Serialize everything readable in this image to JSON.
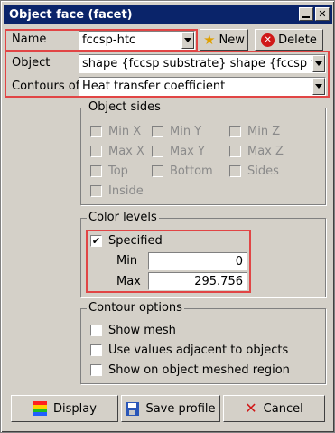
{
  "window": {
    "title": "Object face (facet)"
  },
  "name_row": {
    "label": "Name",
    "value": "fccsp-htc",
    "new_label": "New",
    "delete_label": "Delete"
  },
  "object_row": {
    "label": "Object",
    "value": "shape {fccsp substrate} shape {fccsp flipdie"
  },
  "contours_row": {
    "label": "Contours of",
    "value": "Heat transfer coefficient"
  },
  "object_sides": {
    "title": "Object sides",
    "items": [
      "Min X",
      "Min Y",
      "Min Z",
      "Max X",
      "Max Y",
      "Max Z",
      "Top",
      "Bottom",
      "Sides",
      "Inside"
    ]
  },
  "color_levels": {
    "title": "Color levels",
    "specified_label": "Specified",
    "specified_checked": true,
    "min_label": "Min",
    "min_value": "0",
    "max_label": "Max",
    "max_value": "295.756"
  },
  "contour_options": {
    "title": "Contour options",
    "items": [
      "Show mesh",
      "Use values adjacent to objects",
      "Show on object meshed region"
    ]
  },
  "buttons": {
    "display": "Display",
    "save_profile": "Save profile",
    "cancel": "Cancel"
  },
  "icons": {
    "new": "star-icon",
    "delete": "delete-icon",
    "display": "color-scale-icon",
    "save": "floppy-disk-icon",
    "cancel": "x-icon",
    "minimize": "minimize-icon",
    "close": "close-icon"
  },
  "colors": {
    "highlight_box": "#e14545",
    "titlebar": "#0a246a"
  }
}
